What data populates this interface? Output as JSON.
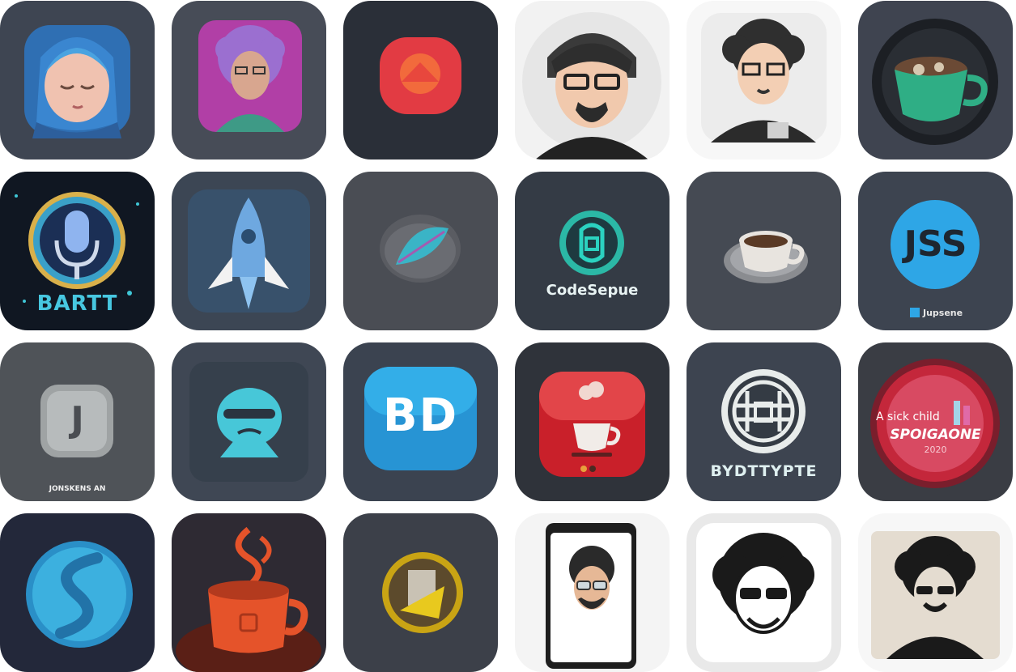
{
  "icons": [
    {
      "name": "sleeping-girl-icon"
    },
    {
      "name": "curly-hair-man-portrait-icon"
    },
    {
      "name": "red-record-button-icon"
    },
    {
      "name": "bearded-man-glasses-icon"
    },
    {
      "name": "curly-hair-glasses-man-icon"
    },
    {
      "name": "coffee-cup-icon"
    },
    {
      "name": "microphone-badge-icon",
      "label": "BARTT"
    },
    {
      "name": "rocket-icon"
    },
    {
      "name": "feather-icon"
    },
    {
      "name": "codesepue-logo-icon",
      "label": "CodeSepue"
    },
    {
      "name": "coffee-cup-saucer-icon"
    },
    {
      "name": "jss-icon",
      "label": "JSS",
      "sublabel": "Jupsene"
    },
    {
      "name": "letter-j-icon",
      "label": "J",
      "sublabel": "JONSKENS AN"
    },
    {
      "name": "ninja-face-icon"
    },
    {
      "name": "bd-logo-icon",
      "label": "BD"
    },
    {
      "name": "red-coffee-icon"
    },
    {
      "name": "celtic-knot-badge-icon",
      "label": "BYDTTYPTE"
    },
    {
      "name": "red-badge-icon",
      "label": "A sick child",
      "label2": "SPOIGAONE",
      "label3": "2020"
    },
    {
      "name": "blue-sphere-icon"
    },
    {
      "name": "steaming-mug-icon"
    },
    {
      "name": "gold-coin-icon"
    },
    {
      "name": "phone-avatar-icon"
    },
    {
      "name": "afro-sunglasses-man-icon"
    },
    {
      "name": "afro-sunglasses-portrait-icon"
    }
  ],
  "colors": {
    "dark_tile": "#3f4450",
    "darker_tile": "#2a2e36",
    "cyan": "#3fc6d6",
    "red": "#d8313a"
  }
}
